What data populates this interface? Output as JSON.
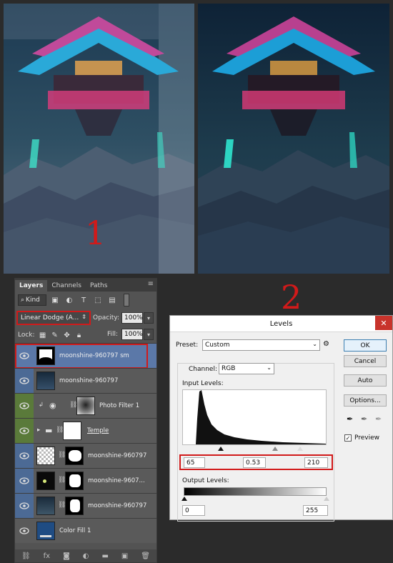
{
  "labels": {
    "before": "1",
    "after": "2"
  },
  "layers_panel": {
    "tabs": [
      "Layers",
      "Channels",
      "Paths"
    ],
    "filter_kind": "Kind",
    "blend_mode": "Linear Dodge (A...",
    "opacity_label": "Opacity:",
    "opacity_value": "100%",
    "lock_label": "Lock:",
    "fill_label": "Fill:",
    "fill_value": "100%",
    "layers": [
      {
        "name": "moonshine-960797 sm",
        "selected": true
      },
      {
        "name": "moonshine-960797"
      },
      {
        "name": "Photo Filter 1"
      },
      {
        "name": "Temple"
      },
      {
        "name": "moonshine-960797"
      },
      {
        "name": "moonshine-9607..."
      },
      {
        "name": "moonshine-960797"
      },
      {
        "name": "Color Fill 1"
      }
    ]
  },
  "levels_dialog": {
    "title": "Levels",
    "preset_label": "Preset:",
    "preset_value": "Custom",
    "channel_label": "Channel:",
    "channel_value": "RGB",
    "input_levels_label": "Input Levels:",
    "input_black": "65",
    "input_gamma": "0.53",
    "input_white": "210",
    "output_levels_label": "Output Levels:",
    "output_black": "0",
    "output_white": "255",
    "buttons": {
      "ok": "OK",
      "cancel": "Cancel",
      "auto": "Auto",
      "options": "Options..."
    },
    "preview_label": "Preview",
    "preview_checked": true
  },
  "colors": {
    "annotation_red": "#d11a1a",
    "panel_bg": "#535353",
    "selected_layer": "#5b78a8"
  }
}
